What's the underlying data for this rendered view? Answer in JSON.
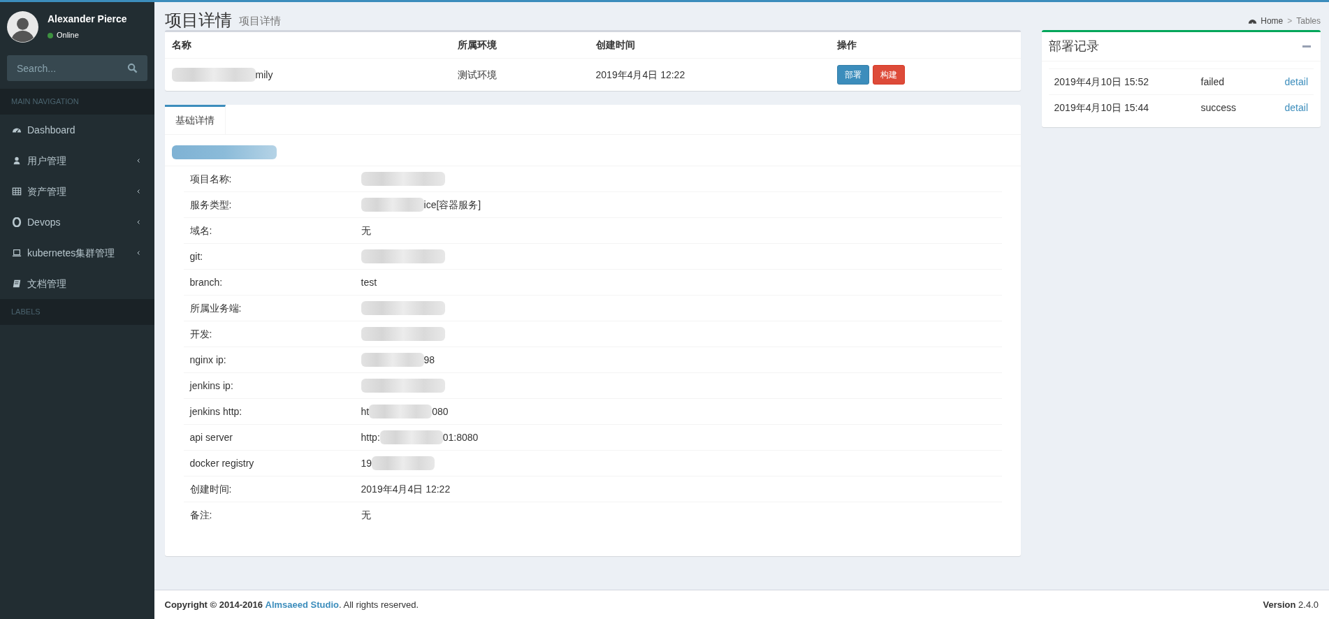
{
  "user": {
    "name": "Alexander Pierce",
    "status": "Online",
    "online": true
  },
  "search": {
    "placeholder": "Search..."
  },
  "nav_header": "MAIN NAVIGATION",
  "nav": [
    {
      "label": "Dashboard",
      "has_children": false
    },
    {
      "label": "用户管理",
      "has_children": true
    },
    {
      "label": "资产管理",
      "has_children": true
    },
    {
      "label": "Devops",
      "has_children": true
    },
    {
      "label": "kubernetes集群管理",
      "has_children": true
    },
    {
      "label": "文档管理",
      "has_children": false
    }
  ],
  "labels_header": "LABELS",
  "page": {
    "title": "项目详情",
    "subtitle": "项目详情"
  },
  "breadcrumb": [
    {
      "label": "Home"
    },
    {
      "label": "Tables"
    }
  ],
  "breadcrumb_separator": ">",
  "summary_table": {
    "columns": [
      "名称",
      "所属环境",
      "创建时间",
      "操作"
    ],
    "row": {
      "name_suffix": "mily",
      "name_redacted": true,
      "env": "测试环境",
      "created": "2019年4月4日 12:22",
      "actions": [
        {
          "label": "部署",
          "kind": "primary"
        },
        {
          "label": "构建",
          "kind": "danger"
        }
      ]
    }
  },
  "tabs": [
    {
      "label": "基础详情",
      "selected": true
    }
  ],
  "details": [
    {
      "label": "项目名称:",
      "redacted": true
    },
    {
      "label": "服务类型:",
      "redacted": true,
      "suffix": "ice[容器服务]"
    },
    {
      "label": "域名:",
      "prefix": "无",
      "redacted": false
    },
    {
      "label": "git:",
      "redacted": true
    },
    {
      "label": "branch:",
      "prefix": "test",
      "redacted": false
    },
    {
      "label": "所属业务端:",
      "redacted": true
    },
    {
      "label": "开发:",
      "redacted": true
    },
    {
      "label": "nginx ip:",
      "redacted": true,
      "suffix": "98"
    },
    {
      "label": "jenkins ip:",
      "redacted": true
    },
    {
      "label": "jenkins http:",
      "prefix": "ht",
      "redacted": true,
      "suffix": "080"
    },
    {
      "label": "api server",
      "prefix": "http:",
      "redacted": true,
      "suffix": "01:8080"
    },
    {
      "label": "docker registry",
      "prefix": "19",
      "redacted": true
    },
    {
      "label": "创建时间:",
      "prefix": "2019年4月4日 12:22",
      "redacted": false
    },
    {
      "label": "备注:",
      "prefix": "无",
      "redacted": false
    }
  ],
  "deploy_log": {
    "title": "部署记录",
    "rows": [
      {
        "time": "2019年4月10日 15:52",
        "status": "failed",
        "link": "detail"
      },
      {
        "time": "2019年4月10日 15:44",
        "status": "success",
        "link": "detail"
      }
    ]
  },
  "footer": {
    "copyright": "**Copyright © 2014-2016** ",
    "company": "Almsaeed Studio",
    "rest": ". All rights reserved.",
    "version": "**Version** 2.4.0"
  }
}
